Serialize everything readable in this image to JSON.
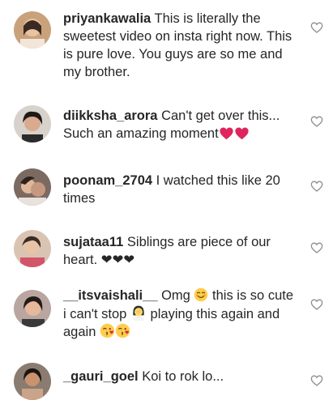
{
  "comments": [
    {
      "username": "priyankawalia",
      "text": "This is literally the sweetest video on insta right now. This is pure love. You guys are so me and my brother.",
      "avatar_icon": "profile-photo",
      "like_icon": "heart-outline-icon"
    },
    {
      "username": "diikksha_arora",
      "text": "Can't get over this... Such an amazing moment",
      "emojis": [
        "red-heart",
        "red-heart"
      ],
      "avatar_icon": "profile-photo",
      "like_icon": "heart-outline-icon"
    },
    {
      "username": "poonam_2704",
      "text": "I watched this like 20 times",
      "avatar_icon": "profile-photo",
      "like_icon": "heart-outline-icon"
    },
    {
      "username": "sujataa11",
      "text": "Siblings are piece of our heart. ❤❤❤",
      "avatar_icon": "profile-photo",
      "like_icon": "heart-outline-icon"
    },
    {
      "username": "__itsvaishali__",
      "text_a": "Omg",
      "text_b": "this is so cute i can't stop",
      "text_c": "playing this again and again",
      "emojis": [
        "smiling-face",
        "woman-facepalming",
        "face-blowing-kiss",
        "face-blowing-kiss"
      ],
      "avatar_icon": "profile-photo",
      "like_icon": "heart-outline-icon"
    },
    {
      "username": "_gauri_goel",
      "text": "Koi to rok lo...",
      "avatar_icon": "profile-photo",
      "like_icon": "heart-outline-icon"
    }
  ],
  "colors": {
    "text": "#262626",
    "heart_outline": "#8e8e8e",
    "red_heart": "#e0245e"
  }
}
